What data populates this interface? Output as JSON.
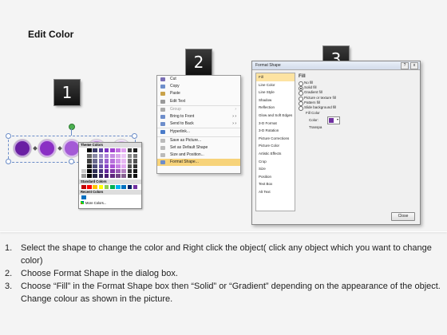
{
  "title": "Edit Color",
  "steps": [
    "1",
    "2",
    "3"
  ],
  "circle_colors": [
    "#6a1fa3",
    "#8a2fc4",
    "#a45ad6",
    "#c28be3",
    "#dcbcf0"
  ],
  "context_menu": {
    "items": [
      {
        "label": "Cut",
        "icon": "scissors-icon",
        "color": "#7a6fb5"
      },
      {
        "label": "Copy",
        "icon": "copy-icon",
        "color": "#6e8ecb"
      },
      {
        "label": "Paste",
        "icon": "paste-icon",
        "color": "#c9a24a"
      },
      {
        "label": "Edit Text",
        "icon": "edit-text-icon",
        "color": "#999999"
      },
      {
        "label": "Group",
        "icon": "group-icon",
        "color": "#aaaaaa",
        "arrow": "›",
        "disabled": true
      },
      {
        "label": "Bring to Front",
        "icon": "bring-front-icon",
        "color": "#6e8ecb",
        "arrow": "› ›"
      },
      {
        "label": "Send to Back",
        "icon": "send-back-icon",
        "color": "#6e8ecb",
        "arrow": "› ›"
      },
      {
        "label": "Hyperlink...",
        "icon": "hyperlink-icon",
        "color": "#4a7bc9"
      },
      {
        "label": "Save as Picture...",
        "icon": "save-picture-icon",
        "color": "#bbbbbb"
      },
      {
        "label": "Set as Default Shape",
        "icon": "default-shape-icon",
        "color": "#bbbbbb"
      },
      {
        "label": "Size and Position...",
        "icon": "size-position-icon",
        "color": "#bbbbbb"
      },
      {
        "label": "Format Shape...",
        "icon": "format-shape-icon",
        "color": "#6e8ecb",
        "highlight": true
      }
    ]
  },
  "dialog": {
    "title": "Format Shape",
    "help_btn": "?",
    "close_btn": "x",
    "categories": [
      "Fill",
      "Line Color",
      "Line Style",
      "Shadow",
      "Reflection",
      "Glow and Soft Edges",
      "3-D Format",
      "3-D Rotation",
      "Picture Corrections",
      "Picture Color",
      "Artistic Effects",
      "Crop",
      "Size",
      "Position",
      "Text Box",
      "Alt Text"
    ],
    "selected_category": "Fill",
    "fill_header": "Fill",
    "fill_options": [
      "No fill",
      "Solid fill",
      "Gradient fill",
      "Picture or texture fill",
      "Pattern fill",
      "Slide background fill"
    ],
    "fill_selected": 1,
    "fill_color_label": "Fill Color",
    "color_label": "Color:",
    "transparency_label": "Transpa",
    "close_label": "Close"
  },
  "palette": {
    "theme_header": "Theme Colors",
    "standard_header": "Standard Colors",
    "recent_header": "Recent Colors",
    "more_colors": "More Colors...",
    "theme_top": [
      "#ffffff",
      "#000000",
      "#3a3a6a",
      "#5b3fa0",
      "#7a2fc0",
      "#a040d0",
      "#c070e0",
      "#e0a0f0",
      "#404040",
      "#1a1a1a"
    ],
    "standard": [
      "#c00000",
      "#ff0000",
      "#ffc000",
      "#ffff00",
      "#92d050",
      "#00b050",
      "#00b0f0",
      "#0070c0",
      "#002060",
      "#7030a0"
    ],
    "recent": [
      "#0070c0"
    ]
  },
  "instructions": [
    {
      "num": "1.",
      "text": "Select the shape to change the color and Right click the object( click any object which you want to change color)"
    },
    {
      "num": "2.",
      "text": "Choose Format Shape in the dialog box."
    },
    {
      "num": "3.",
      "text": "Choose “Fill” in the Format Shape box then “Solid” or “Gradient” depending on the appearance of the object. Change colour as shown in the picture."
    }
  ]
}
